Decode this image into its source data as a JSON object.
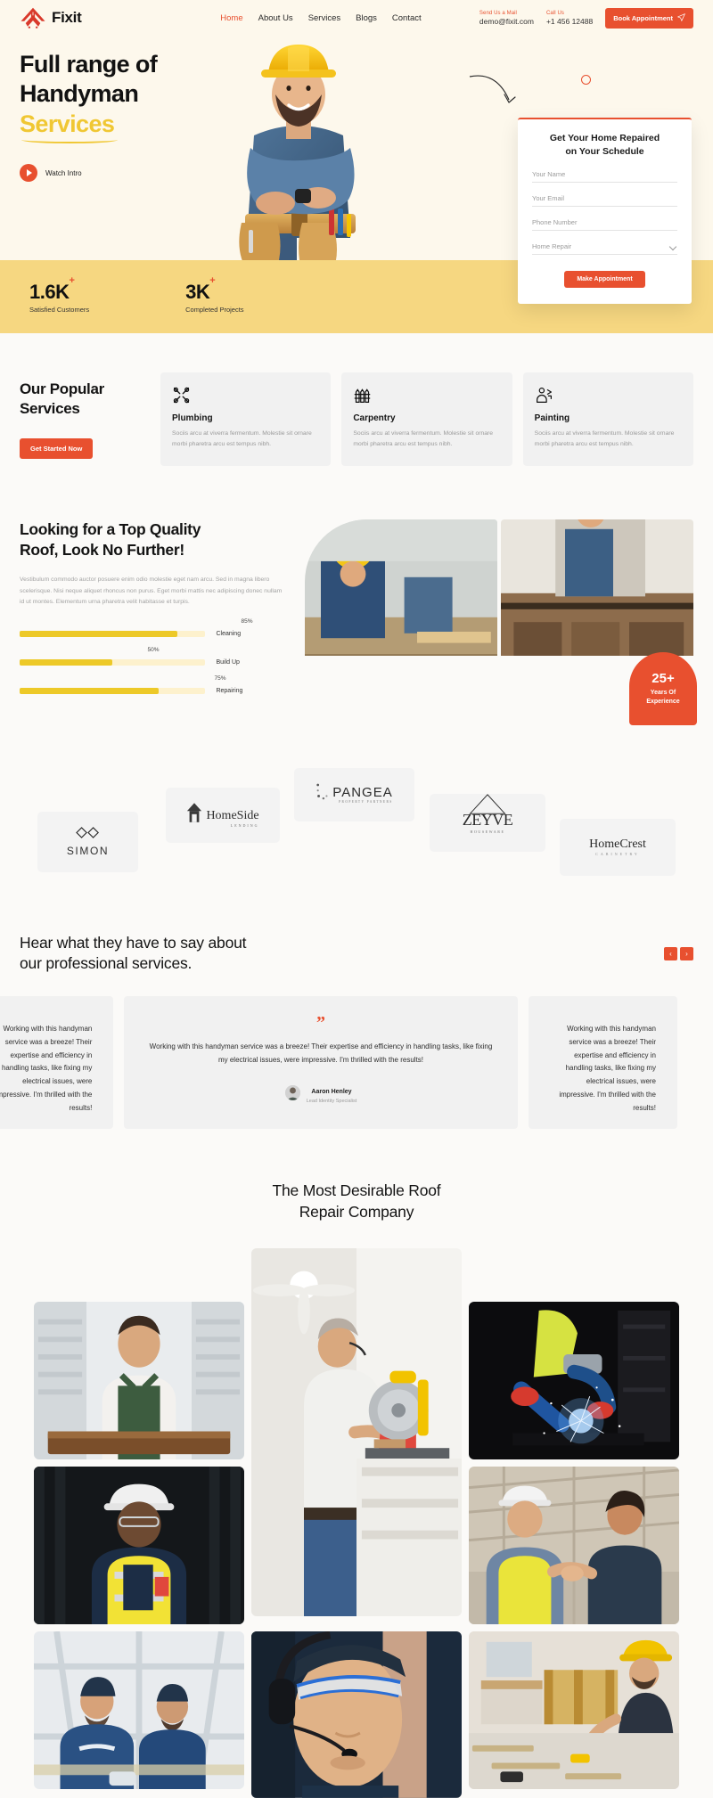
{
  "brand": {
    "name": "Fixit",
    "logo_icon": "house-tools-logo-icon"
  },
  "nav": {
    "items": [
      {
        "label": "Home",
        "active": true
      },
      {
        "label": "About Us",
        "active": false
      },
      {
        "label": "Services",
        "active": false
      },
      {
        "label": "Blogs",
        "active": false
      },
      {
        "label": "Contact",
        "active": false
      }
    ]
  },
  "header": {
    "mail_label": "Send Us a Mail",
    "mail_value": "demo@fixit.com",
    "call_label": "Call Us",
    "call_value": "+1 456 12488",
    "book_button": "Book Appointment",
    "book_icon": "paper-plane-icon"
  },
  "hero": {
    "title_line1": "Full range of",
    "title_line2": "Handyman",
    "title_highlight": "Services",
    "watch_label": "Watch Intro",
    "play_icon": "play-circle-icon",
    "worker_image_alt": "handyman-with-yellow-hard-hat"
  },
  "form": {
    "title_line1": "Get Your Home Repaired",
    "title_line2": "on Your Schedule",
    "fields": [
      {
        "name": "name",
        "placeholder": "Your Name",
        "value": ""
      },
      {
        "name": "email",
        "placeholder": "Your Email",
        "value": ""
      },
      {
        "name": "phone",
        "placeholder": "Phone Number",
        "value": ""
      }
    ],
    "select": {
      "placeholder": "Home Repair",
      "value": "Home Repair",
      "icon": "chevron-down-icon"
    },
    "submit_label": "Make Appointment"
  },
  "stats": {
    "items": [
      {
        "number": "1.6K",
        "plus": "+",
        "label": "Satisfied Customers"
      },
      {
        "number": "3K",
        "plus": "+",
        "label": "Completed Projects"
      }
    ]
  },
  "services": {
    "heading_line1": "Our Popular",
    "heading_line2": "Services",
    "cta_label": "Get Started Now",
    "cards": [
      {
        "icon": "crossed-wrench-screwdriver-icon",
        "title": "Plumbing",
        "desc": "Sociis arcu at viverra fermentum. Molestie sit ornare morbi pharetra arcu est tempus nibh."
      },
      {
        "icon": "wooden-fence-icon",
        "title": "Carpentry",
        "desc": "Sociis arcu at viverra fermentum. Molestie sit ornare morbi pharetra arcu est tempus nibh."
      },
      {
        "icon": "painter-worker-icon",
        "title": "Painting",
        "desc": "Sociis arcu at viverra fermentum. Molestie sit ornare morbi pharetra arcu est tempus nibh."
      }
    ]
  },
  "roof": {
    "heading_line1": "Looking for a Top Quality",
    "heading_line2": "Roof, Look No Further!",
    "paragraph": "Vestibulum commodo auctor posuere enim odio molestie eget nam arcu. Sed in magna libero scelerisque. Nisi neque aliquet rhoncus non purus. Eget morbi mattis nec adipiscing donec nullam id ut montes. Elementum urna pharetra velit habitasse et turpis.",
    "skills": [
      {
        "label": "Cleaning",
        "percent": 85,
        "percent_text": "85%"
      },
      {
        "label": "Build Up",
        "percent": 50,
        "percent_text": "50%"
      },
      {
        "label": "Repairing",
        "percent": 75,
        "percent_text": "75%"
      }
    ],
    "badge": {
      "number": "25+",
      "line1": "Years Of",
      "line2": "Experience"
    },
    "image_left_alt": "roofer-on-rooftop",
    "image_right_alt": "carpenter-in-kitchen"
  },
  "logos": {
    "items": [
      {
        "name": "SIMON",
        "sub": "",
        "mark": "diamonds-icon"
      },
      {
        "name": "HomeSide",
        "sub": "LENDING",
        "mark": "house-block-icon"
      },
      {
        "name": "PANGEA",
        "sub": "PROPERTY PARTNERS",
        "mark": "dots-icon"
      },
      {
        "name": "ZEYVE",
        "sub": "HOUSEWARE",
        "mark": "house-outline-icon"
      },
      {
        "name": "HomeCrest",
        "sub": "CABINETRY",
        "mark": "none"
      }
    ]
  },
  "testimonials": {
    "heading_line1": "Hear what they have to say about",
    "heading_line2": "our professional services.",
    "prev_icon": "chevron-left-icon",
    "next_icon": "chevron-right-icon",
    "quote_icon": "quotation-mark-icon",
    "cards": [
      {
        "text": "Working with this handyman service was a breeze! Their expertise and efficiency in handling tasks, like fixing my electrical issues, were impressive. I'm thrilled with the results!",
        "author": "",
        "role": ""
      },
      {
        "text": "Working with this handyman service was a breeze! Their expertise and efficiency in handling tasks, like fixing my electrical issues, were impressive. I'm thrilled with the results!",
        "author": "Aaron Henley",
        "role": "Lead Identity Specialist"
      },
      {
        "text": "Working with this handyman service was a breeze! Their expertise and efficiency in handling tasks, like fixing my electrical issues, were impressive. I'm thrilled with the results!",
        "author": "",
        "role": ""
      }
    ]
  },
  "gallery": {
    "heading_line1": "The Most Desirable Roof",
    "heading_line2": "Repair Company",
    "items": [
      {
        "alt": "carpenter-holding-wood-plank"
      },
      {
        "alt": "man-using-miter-saw-indoors"
      },
      {
        "alt": "welder-with-sparks"
      },
      {
        "alt": "worker-in-yellow-safety-vest"
      },
      {
        "alt": "engineer-with-headset-looking-up"
      },
      {
        "alt": "two-workers-shaking-hands"
      },
      {
        "alt": "two-workers-on-scaffolding"
      },
      {
        "alt": "handyman-repairing-wall"
      }
    ]
  },
  "colors": {
    "accent": "#e8502f",
    "yellow": "#edc928",
    "hero_bg": "#fdf8ec",
    "band": "#f6d781",
    "page_bg": "#fbfaf8",
    "card_bg": "#f1f1f1"
  }
}
